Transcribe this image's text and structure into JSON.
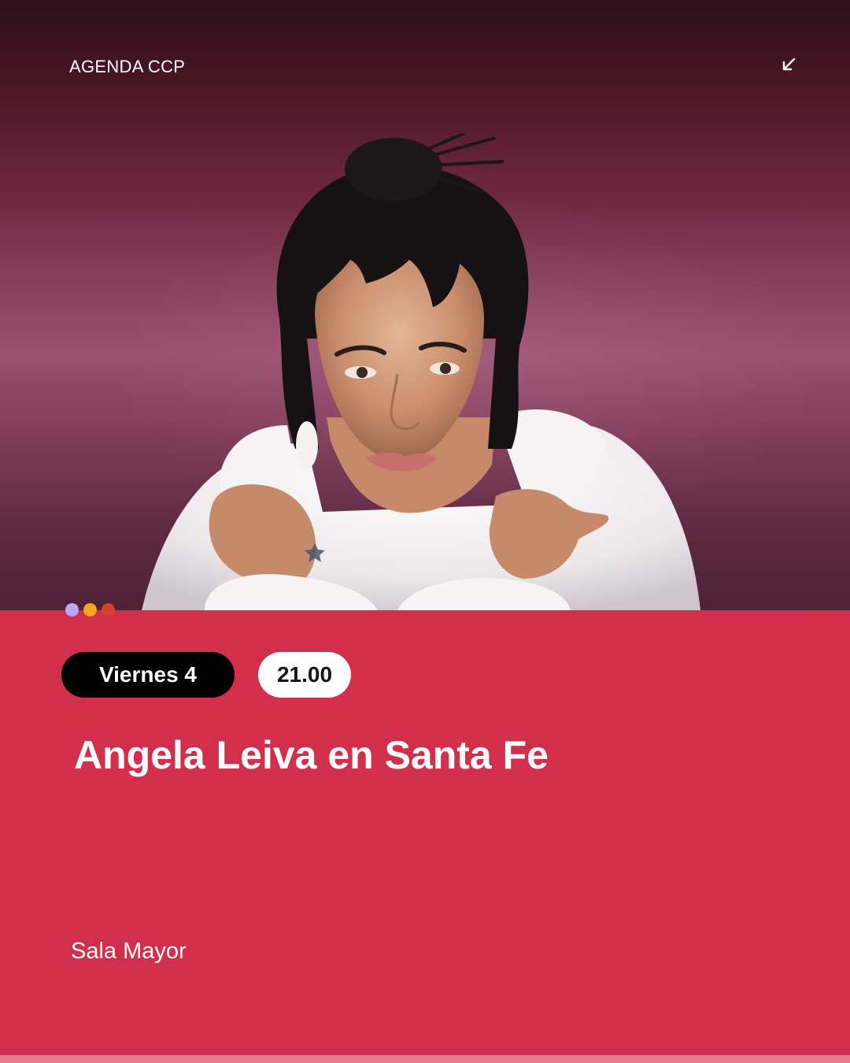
{
  "header": {
    "brand": "AGENDA CCP",
    "corner_icon": "arrow-down-left-icon"
  },
  "hero": {
    "image": "portrait-photo",
    "indicator_colors": [
      "#b9a8f5",
      "#f7a423",
      "#d6402e"
    ]
  },
  "event": {
    "day_label": "Viernes 4",
    "time_label": "21.00",
    "title": "Angela Leiva en Santa Fe",
    "venue": "Sala Mayor"
  },
  "colors": {
    "accent": "#d12f4c",
    "day_pill_bg": "#000000",
    "time_pill_bg": "#ffffff"
  }
}
